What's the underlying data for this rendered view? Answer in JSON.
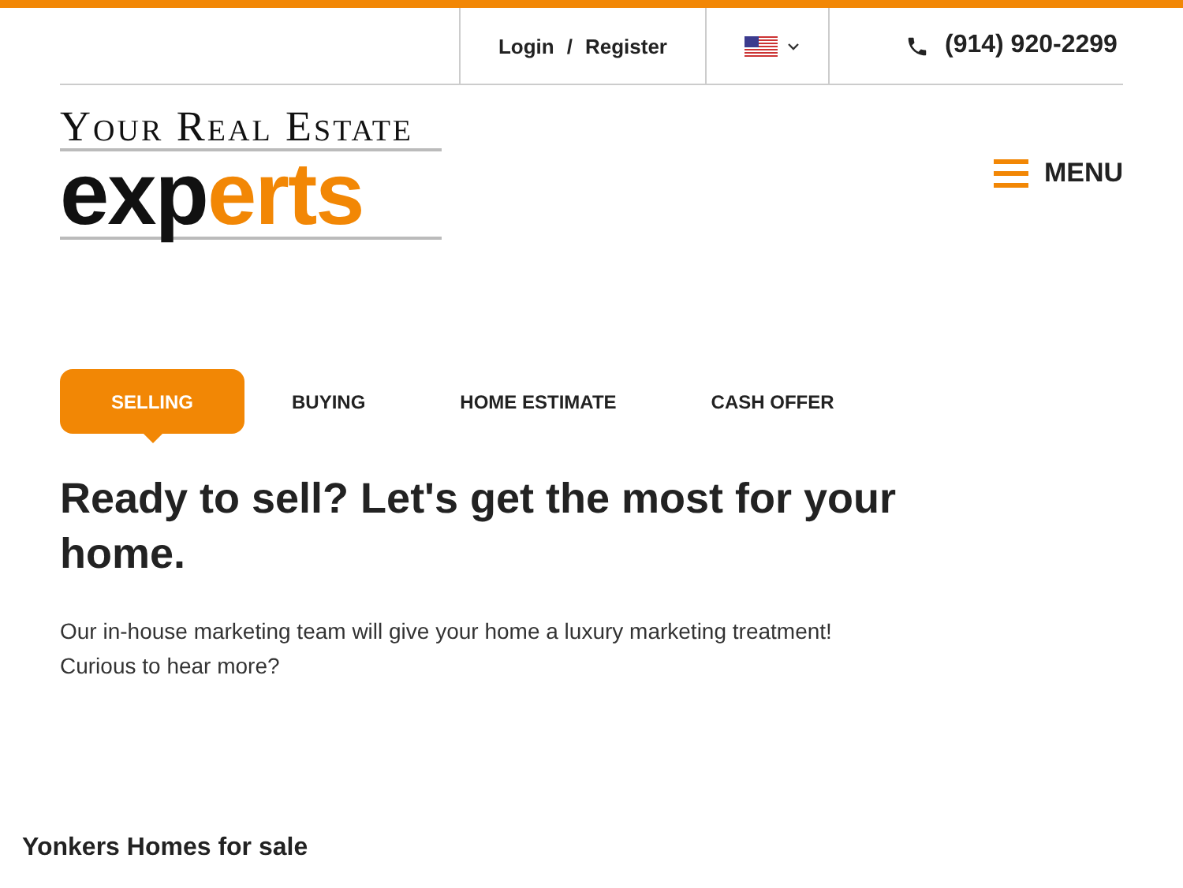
{
  "top_bar": {
    "login": "Login",
    "separator": "/",
    "register": "Register",
    "phone": "(914) 920-2299"
  },
  "logo": {
    "tagline": "Your Real Estate",
    "word_dark": "exp",
    "word_accent": "erts"
  },
  "menu": {
    "label": "MENU"
  },
  "tabs": [
    {
      "label": "SELLING",
      "selected": true
    },
    {
      "label": "BUYING",
      "selected": false
    },
    {
      "label": "HOME ESTIMATE",
      "selected": false
    },
    {
      "label": "CASH OFFER",
      "selected": false
    }
  ],
  "heading": "Ready to sell? Let's get the most for your home.",
  "description": "Our in-house marketing team will give your home a luxury marketing treatment! Curious to hear more?",
  "section_title": "Yonkers Homes for sale"
}
